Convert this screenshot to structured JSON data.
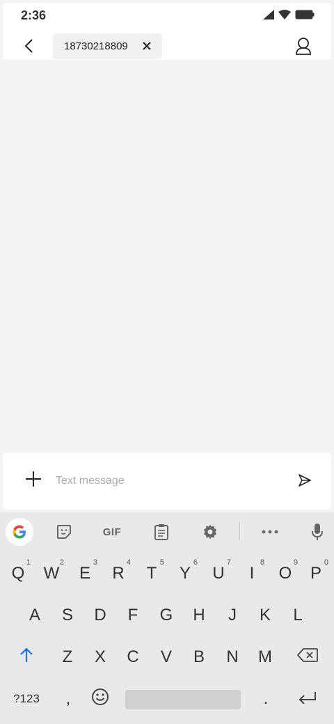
{
  "status_bar": {
    "time": "2:36",
    "icons": [
      "signal-icon",
      "wifi-icon",
      "battery-icon"
    ]
  },
  "header": {
    "back_icon": "back-arrow-icon",
    "recipient": "18730218809",
    "remove_icon": "close-icon",
    "contact_icon": "contact-icon"
  },
  "compose": {
    "add_icon": "plus-icon",
    "placeholder": "Text message",
    "value": "",
    "send_icon": "send-icon"
  },
  "keyboard": {
    "toolbar": {
      "google_icon": "google-icon",
      "sticker_icon": "sticker-icon",
      "gif_label": "GIF",
      "clipboard_icon": "clipboard-icon",
      "settings_icon": "gear-icon",
      "more_icon": "more-icon",
      "mic_icon": "mic-icon"
    },
    "row1": [
      {
        "key": "Q",
        "hint": "1"
      },
      {
        "key": "W",
        "hint": "2"
      },
      {
        "key": "E",
        "hint": "3"
      },
      {
        "key": "R",
        "hint": "4"
      },
      {
        "key": "T",
        "hint": "5"
      },
      {
        "key": "Y",
        "hint": "6"
      },
      {
        "key": "U",
        "hint": "7"
      },
      {
        "key": "I",
        "hint": "8"
      },
      {
        "key": "O",
        "hint": "9"
      },
      {
        "key": "P",
        "hint": "0"
      }
    ],
    "row2": [
      "A",
      "S",
      "D",
      "F",
      "G",
      "H",
      "J",
      "K",
      "L"
    ],
    "row3": [
      "Z",
      "X",
      "C",
      "V",
      "B",
      "N",
      "M"
    ],
    "row4": {
      "symbols": "?123",
      "comma": ",",
      "period": "."
    },
    "colors": {
      "shift_accent": "#1a73e8"
    }
  }
}
